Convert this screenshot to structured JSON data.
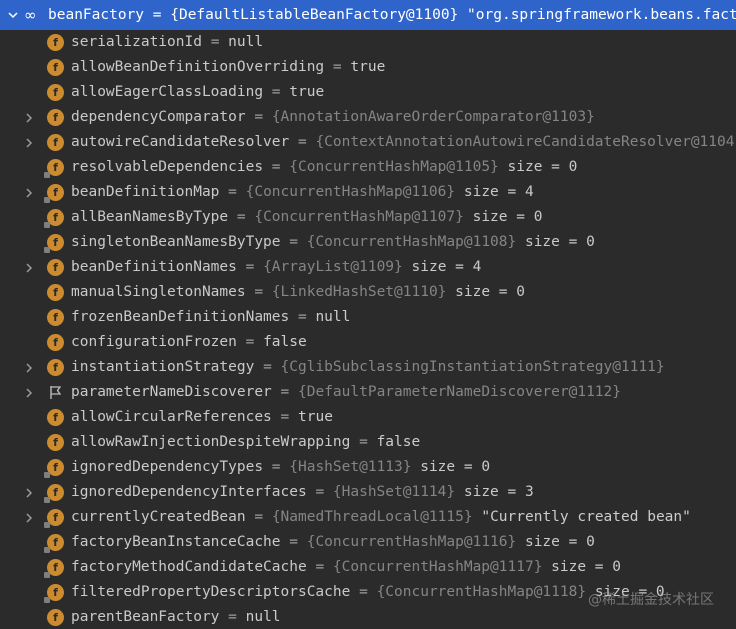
{
  "root": {
    "name": "beanFactory",
    "eq": "=",
    "value": "{DefaultListableBeanFactory@1100} \"org.springframework.beans.factory"
  },
  "fields": [
    {
      "name": "serializationId",
      "eq": "=",
      "ref": "",
      "value": "null",
      "size": "",
      "expandable": false,
      "icon": "field"
    },
    {
      "name": "allowBeanDefinitionOverriding",
      "eq": "=",
      "ref": "",
      "value": "true",
      "size": "",
      "expandable": false,
      "icon": "field"
    },
    {
      "name": "allowEagerClassLoading",
      "eq": "=",
      "ref": "",
      "value": "true",
      "size": "",
      "expandable": false,
      "icon": "field"
    },
    {
      "name": "dependencyComparator",
      "eq": "=",
      "ref": "{AnnotationAwareOrderComparator@1103}",
      "value": "",
      "size": "",
      "expandable": true,
      "icon": "field"
    },
    {
      "name": "autowireCandidateResolver",
      "eq": "=",
      "ref": "{ContextAnnotationAutowireCandidateResolver@1104}",
      "value": "",
      "size": "",
      "expandable": true,
      "icon": "field"
    },
    {
      "name": "resolvableDependencies",
      "eq": "=",
      "ref": "{ConcurrentHashMap@1105}",
      "value": "",
      "size": "size = 0",
      "expandable": false,
      "icon": "field-final"
    },
    {
      "name": "beanDefinitionMap",
      "eq": "=",
      "ref": "{ConcurrentHashMap@1106}",
      "value": "",
      "size": "size = 4",
      "expandable": true,
      "icon": "field-final"
    },
    {
      "name": "allBeanNamesByType",
      "eq": "=",
      "ref": "{ConcurrentHashMap@1107}",
      "value": "",
      "size": "size = 0",
      "expandable": false,
      "icon": "field-final"
    },
    {
      "name": "singletonBeanNamesByType",
      "eq": "=",
      "ref": "{ConcurrentHashMap@1108}",
      "value": "",
      "size": "size = 0",
      "expandable": false,
      "icon": "field-final"
    },
    {
      "name": "beanDefinitionNames",
      "eq": "=",
      "ref": "{ArrayList@1109}",
      "value": "",
      "size": "size = 4",
      "expandable": true,
      "icon": "field"
    },
    {
      "name": "manualSingletonNames",
      "eq": "=",
      "ref": "{LinkedHashSet@1110}",
      "value": "",
      "size": "size = 0",
      "expandable": false,
      "icon": "field"
    },
    {
      "name": "frozenBeanDefinitionNames",
      "eq": "=",
      "ref": "",
      "value": "null",
      "size": "",
      "expandable": false,
      "icon": "field"
    },
    {
      "name": "configurationFrozen",
      "eq": "=",
      "ref": "",
      "value": "false",
      "size": "",
      "expandable": false,
      "icon": "field"
    },
    {
      "name": "instantiationStrategy",
      "eq": "=",
      "ref": "{CglibSubclassingInstantiationStrategy@1111}",
      "value": "",
      "size": "",
      "expandable": true,
      "icon": "field"
    },
    {
      "name": "parameterNameDiscoverer",
      "eq": "=",
      "ref": "{DefaultParameterNameDiscoverer@1112}",
      "value": "",
      "size": "",
      "expandable": true,
      "icon": "flag"
    },
    {
      "name": "allowCircularReferences",
      "eq": "=",
      "ref": "",
      "value": "true",
      "size": "",
      "expandable": false,
      "icon": "field"
    },
    {
      "name": "allowRawInjectionDespiteWrapping",
      "eq": "=",
      "ref": "",
      "value": "false",
      "size": "",
      "expandable": false,
      "icon": "field"
    },
    {
      "name": "ignoredDependencyTypes",
      "eq": "=",
      "ref": "{HashSet@1113}",
      "value": "",
      "size": "size = 0",
      "expandable": false,
      "icon": "field-final"
    },
    {
      "name": "ignoredDependencyInterfaces",
      "eq": "=",
      "ref": "{HashSet@1114}",
      "value": "",
      "size": "size = 3",
      "expandable": true,
      "icon": "field-final"
    },
    {
      "name": "currentlyCreatedBean",
      "eq": "=",
      "ref": "{NamedThreadLocal@1115}",
      "value": "\"Currently created bean\"",
      "size": "",
      "expandable": true,
      "icon": "field-final"
    },
    {
      "name": "factoryBeanInstanceCache",
      "eq": "=",
      "ref": "{ConcurrentHashMap@1116}",
      "value": "",
      "size": "size = 0",
      "expandable": false,
      "icon": "field-final"
    },
    {
      "name": "factoryMethodCandidateCache",
      "eq": "=",
      "ref": "{ConcurrentHashMap@1117}",
      "value": "",
      "size": "size = 0",
      "expandable": false,
      "icon": "field-final"
    },
    {
      "name": "filteredPropertyDescriptorsCache",
      "eq": "=",
      "ref": "{ConcurrentHashMap@1118}",
      "value": "",
      "size": "size = 0",
      "expandable": false,
      "icon": "field-final"
    },
    {
      "name": "parentBeanFactory",
      "eq": "=",
      "ref": "",
      "value": "null",
      "size": "",
      "expandable": false,
      "icon": "field"
    }
  ],
  "watermark": "@稀土掘金技术社区",
  "colors": {
    "selection": "#2f65ca",
    "background": "#2b2b2b",
    "field_icon": "#cd8b2f"
  }
}
